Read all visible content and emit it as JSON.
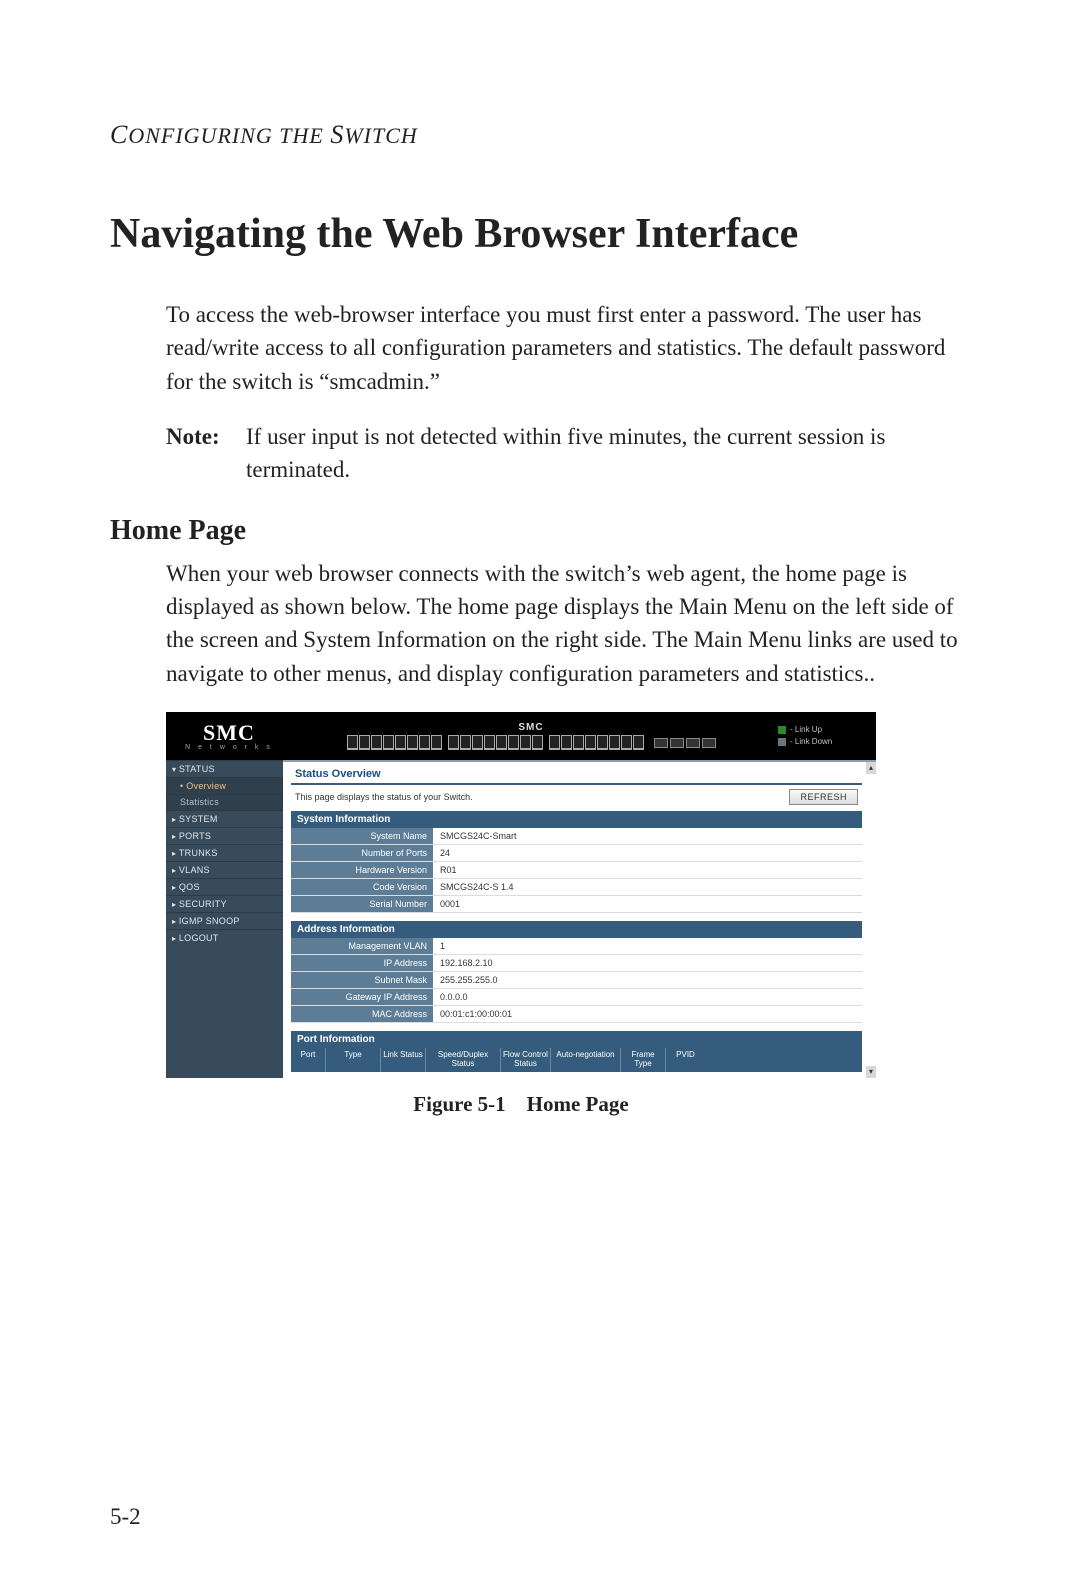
{
  "running_head": "Configuring the Switch",
  "title": "Navigating the Web Browser Interface",
  "intro_paragraph": "To access the web-browser interface you must first enter a password. The user has read/write access to all configuration parameters and statistics. The default password for the switch is “smcadmin.”",
  "note": {
    "label": "Note:",
    "body": "If user input is not detected within five minutes, the current session is terminated."
  },
  "subhead": "Home Page",
  "home_paragraph": "When your web browser connects with the switch’s web agent, the home page is displayed as shown below. The home page displays the Main Menu on the left side of the screen and System Information on the right side. The Main Menu links are used to navigate to other menus, and display configuration parameters and statistics..",
  "screenshot": {
    "logo_main": "SMC",
    "logo_sub": "N e t w o r k s",
    "banner_brand": "SMC",
    "legend": {
      "up": "- Link Up",
      "down": "- Link Down"
    },
    "sidebar": {
      "status": "STATUS",
      "overview": "Overview",
      "statistics": "Statistics",
      "system": "SYSTEM",
      "ports": "PORTS",
      "trunks": "TRUNKS",
      "vlans": "VLANS",
      "qos": "QOS",
      "security": "SECURITY",
      "igmp": "IGMP SNOOP",
      "logout": "LOGOUT"
    },
    "content": {
      "title": "Status Overview",
      "description": "This page displays the status of your Switch.",
      "refresh_label": "REFRESH",
      "system_info": {
        "title": "System Information",
        "rows": {
          "system_name": {
            "label": "System Name",
            "value": "SMCGS24C-Smart"
          },
          "num_ports": {
            "label": "Number of Ports",
            "value": "24"
          },
          "hw_version": {
            "label": "Hardware Version",
            "value": "R01"
          },
          "code_version": {
            "label": "Code Version",
            "value": "SMCGS24C-S 1.4"
          },
          "serial": {
            "label": "Serial Number",
            "value": "0001"
          }
        }
      },
      "address_info": {
        "title": "Address Information",
        "rows": {
          "mgmt_vlan": {
            "label": "Management VLAN",
            "value": "1"
          },
          "ip": {
            "label": "IP Address",
            "value": "192.168.2.10"
          },
          "subnet": {
            "label": "Subnet Mask",
            "value": "255.255.255.0"
          },
          "gateway": {
            "label": "Gateway IP Address",
            "value": "0.0.0.0"
          },
          "mac": {
            "label": "MAC Address",
            "value": "00:01:c1:00:00:01"
          }
        }
      },
      "port_info": {
        "title": "Port Information",
        "headers": {
          "port": "Port",
          "type": "Type",
          "link": "Link Status",
          "speed": "Speed/Duplex Status",
          "flow": "Flow Control Status",
          "auto": "Auto-negotiation",
          "frame": "Frame Type",
          "pvid": "PVID"
        }
      }
    }
  },
  "figure_caption": "Figure 5-1 Home Page",
  "page_number": "5-2"
}
